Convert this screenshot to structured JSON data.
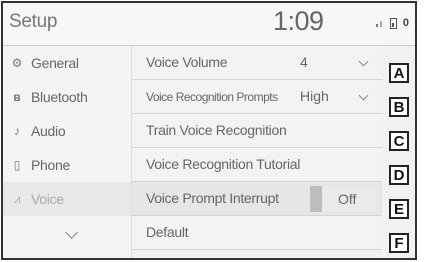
{
  "header": {
    "title": "Setup",
    "clock": "1:09",
    "status_text": "0"
  },
  "sidebar": {
    "items": [
      {
        "label": "General",
        "icon": "gear-icon"
      },
      {
        "label": "Bluetooth",
        "icon": "bluetooth-icon"
      },
      {
        "label": "Audio",
        "icon": "music-note-icon"
      },
      {
        "label": "Phone",
        "icon": "phone-icon"
      },
      {
        "label": "Voice",
        "icon": "voice-icon",
        "selected": true
      }
    ],
    "more_icon": "chevron-down-icon"
  },
  "settings": {
    "rows": [
      {
        "label": "Voice Volume",
        "value": "4",
        "control": "dropdown"
      },
      {
        "label": "Voice Recognition Prompts",
        "value": "High",
        "control": "dropdown"
      },
      {
        "label": "Train Voice Recognition"
      },
      {
        "label": "Voice Recognition Tutorial"
      },
      {
        "label": "Voice Prompt Interrupt",
        "value": "Off",
        "control": "toggle"
      },
      {
        "label": "Default"
      }
    ]
  },
  "callouts": [
    "A",
    "B",
    "C",
    "D",
    "E",
    "F"
  ]
}
